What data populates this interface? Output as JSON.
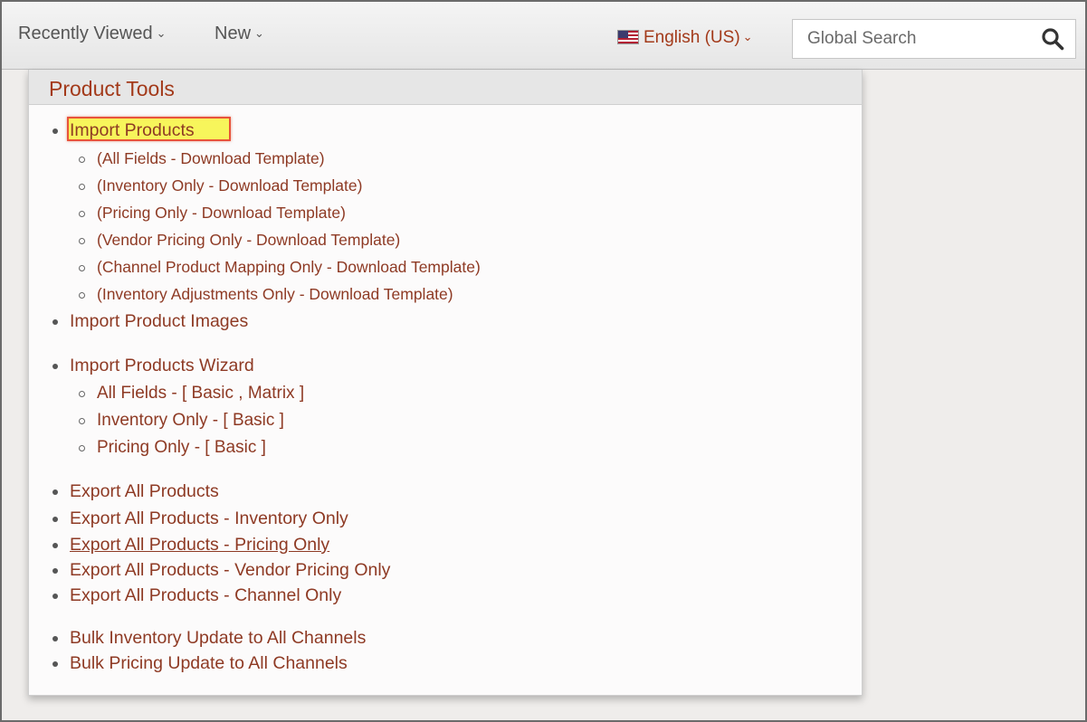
{
  "topbar": {
    "recently_viewed": "Recently Viewed",
    "new": "New",
    "language": "English (US)",
    "search_placeholder": "Global Search"
  },
  "panel": {
    "title": "Product Tools",
    "items": [
      "Import Products",
      "(All Fields - Download Template)",
      "(Inventory Only - Download Template)",
      "(Pricing Only - Download Template)",
      "(Vendor Pricing Only - Download Template)",
      "(Channel Product Mapping Only - Download Template)",
      "(Inventory Adjustments Only - Download Template)",
      "Import Product Images",
      "Import Products Wizard",
      "All Fields - [ Basic , Matrix ]",
      "Inventory Only - [ Basic ]",
      "Pricing Only - [ Basic ]",
      "Export All Products",
      "Export All Products - Inventory Only",
      "Export All Products - Pricing Only",
      "Export All Products - Vendor Pricing Only",
      "Export All Products - Channel Only",
      "Bulk Inventory Update to All Channels",
      "Bulk Pricing Update to All Channels"
    ]
  },
  "colors": {
    "link": "#8e3a24",
    "accent": "#a33a1a",
    "highlight": "#f7f55b",
    "highlight_border": "#e8533a"
  }
}
